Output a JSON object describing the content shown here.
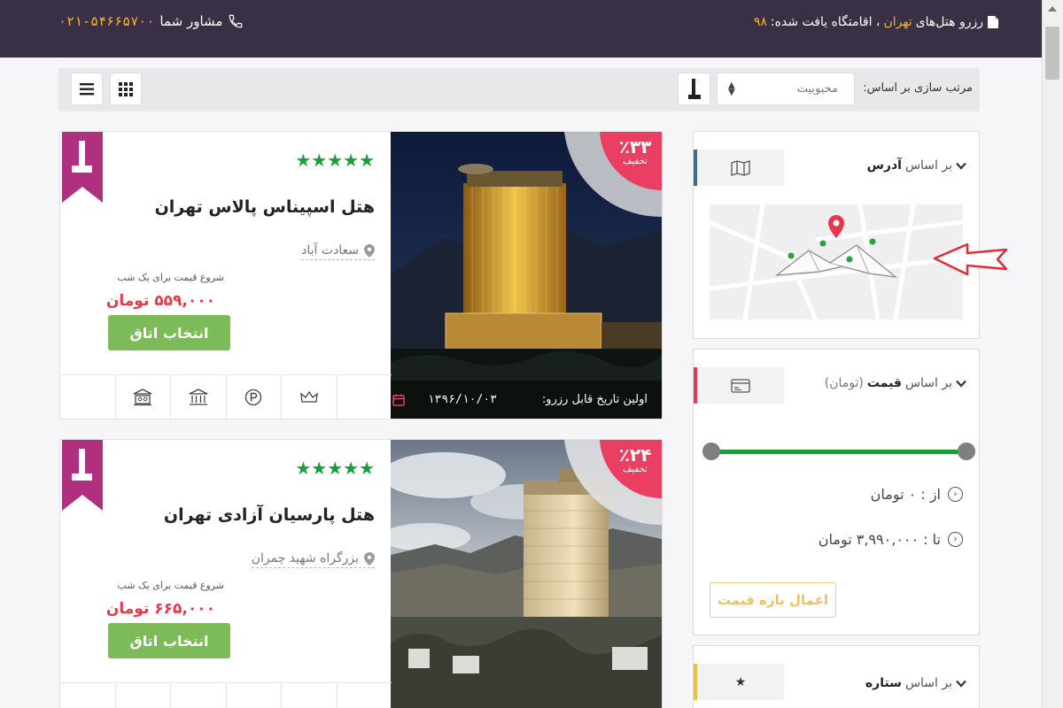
{
  "header": {
    "phone_label": "مشاور شما",
    "phone_number": "۰۲۱-۵۴۶۶۵۷۰۰",
    "search_prefix": "رزرو هتل‌های",
    "city": "تهران",
    "found_label": "، اقامتگاه یافت شده:",
    "found_count": "۹۸"
  },
  "sortbar": {
    "sort_label": "مرتب سازی بر اساس:",
    "sort_value": "محبوبیت"
  },
  "hotels": [
    {
      "name": "هتل اسپیناس پالاس تهران",
      "stars": "★★★★★",
      "location": "سعادت آباد",
      "price_label": "شروع قیمت برای یک شب",
      "price": "۵۵۹,۰۰۰ تومان",
      "select_label": "انتخاب اتاق",
      "discount_pct": "٪۳۳",
      "discount_label": "تخفیف",
      "booking_label": "اولین تاریخ قابل رزرو:",
      "booking_date": "۱۳۹۶/۱۰/۰۳"
    },
    {
      "name": "هتل پارسیان آزادی تهران",
      "stars": "★★★★★",
      "location": "بزرگراه شهید چمران",
      "price_label": "شروع قیمت برای یک شب",
      "price": "۶۶۵,۰۰۰ تومان",
      "select_label": "انتخاب اتاق",
      "discount_pct": "٪۲۴",
      "discount_label": "تخفیف"
    }
  ],
  "filters": {
    "address": {
      "prefix": "بر اساس",
      "title": "آدرس"
    },
    "price": {
      "prefix": "بر اساس",
      "title": "قیمت",
      "unit": "(تومان)",
      "from": "از : ۰ تومان",
      "to": "تا : ۳,۹۹۰,۰۰۰ تومان",
      "apply_label": "اعمال بازه قیمت"
    },
    "stars": {
      "prefix": "بر اساس",
      "title": "ستاره"
    }
  },
  "colors": {
    "header_bg": "#3a3046",
    "accent_yellow": "#f2b531",
    "discount_pink": "#ea3e63",
    "ribbon_magenta": "#b0307f",
    "star_green": "#13a13a",
    "button_green": "#7cbb58",
    "price_red": "#e8364a",
    "slider_green": "#1f9a38"
  }
}
